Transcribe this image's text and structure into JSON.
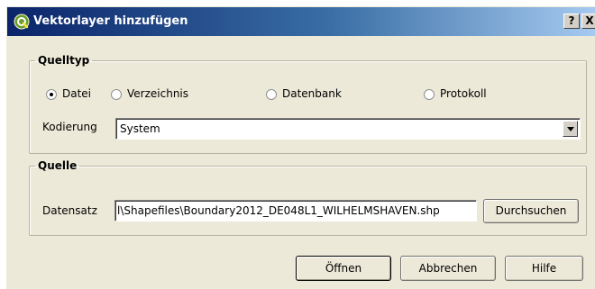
{
  "window": {
    "title": "Vektorlayer hinzufügen",
    "help_button": "?",
    "close_button": "X"
  },
  "source_type": {
    "legend": "Quelltyp",
    "options": [
      "Datei",
      "Verzeichnis",
      "Datenbank",
      "Protokoll"
    ],
    "selected": "Datei",
    "encoding_label": "Kodierung",
    "encoding_value": "System"
  },
  "source": {
    "legend": "Quelle",
    "dataset_label": "Datensatz",
    "dataset_value": "l\\Shapefiles\\Boundary2012_DE048L1_WILHELMSHAVEN.shp",
    "browse_label": "Durchsuchen"
  },
  "buttons": {
    "open": "Öffnen",
    "cancel": "Abbrechen",
    "help": "Hilfe"
  },
  "colors": {
    "dialog_bg": "#ece9d8",
    "titlebar_start": "#0a246a",
    "titlebar_end": "#a6caf0",
    "app_icon": "#6a9c2d"
  }
}
